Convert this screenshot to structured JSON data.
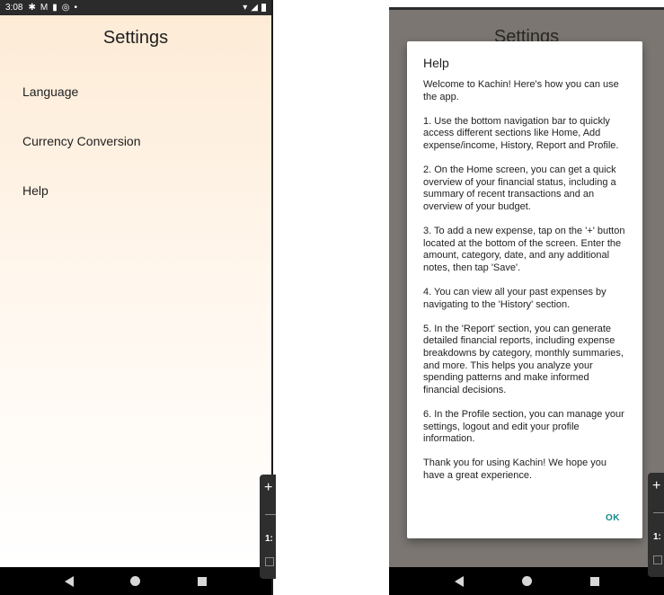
{
  "status_bar": {
    "time": "3:08",
    "dot": "•"
  },
  "settings": {
    "title": "Settings",
    "items": [
      {
        "label": "Language"
      },
      {
        "label": "Currency Conversion"
      },
      {
        "label": "Help"
      }
    ]
  },
  "help_dialog": {
    "title": "Help",
    "paragraphs": [
      "Welcome to Kachin! Here's how you can use the app.",
      "1. Use the bottom navigation bar to quickly access different sections like Home, Add expense/income, History, Report and Profile.",
      "2. On the Home screen, you can get a quick overview of your financial status, including a summary of recent transactions and an overview of your budget.",
      "3. To add a new expense, tap on the '+' button located at the bottom of the screen. Enter the amount, category, date, and any additional notes, then tap 'Save'.",
      "4. You can view all your past expenses by navigating to the 'History' section.",
      "5. In the 'Report' section, you can generate detailed financial reports, including expense breakdowns by category, monthly summaries, and more. This helps you analyze your spending patterns and make informed financial decisions.",
      "6. In the Profile section, you can manage your settings, logout and edit your profile information.",
      "Thank you for using Kachin! We hope you have a great experience."
    ],
    "ok_label": "OK"
  },
  "float_tool": {
    "plus": "+",
    "num": "1:"
  },
  "colors": {
    "accent": "#138a8a",
    "background_top": "#fdebd6",
    "scrim": "#7b7672"
  }
}
